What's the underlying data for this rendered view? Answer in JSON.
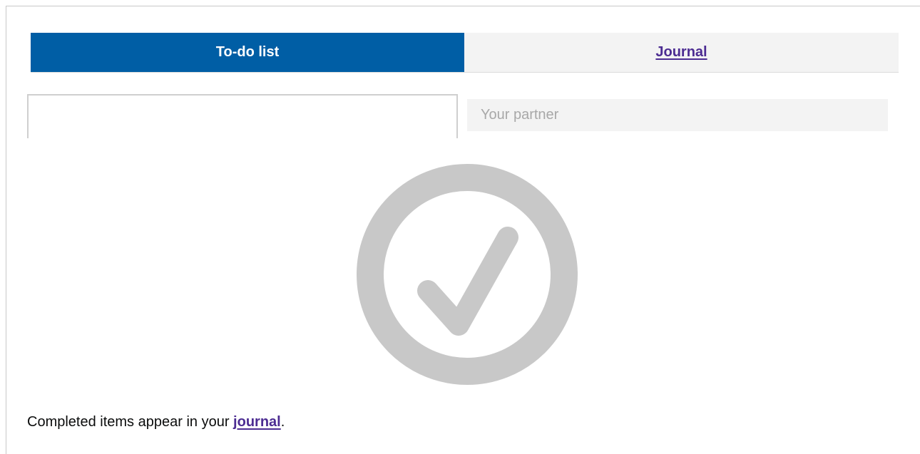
{
  "tabs": {
    "active_label": "To-do list",
    "inactive_label": "Journal"
  },
  "partner": {
    "label": "Your partner"
  },
  "empty_state": {
    "icon": "checkmark-circle-icon",
    "message_prefix": "Completed items appear in your ",
    "link_text": "journal",
    "message_suffix": "."
  },
  "colors": {
    "tab_active_bg": "#005ea5",
    "link": "#4c2c92",
    "icon_grey": "#c8c8c8"
  }
}
